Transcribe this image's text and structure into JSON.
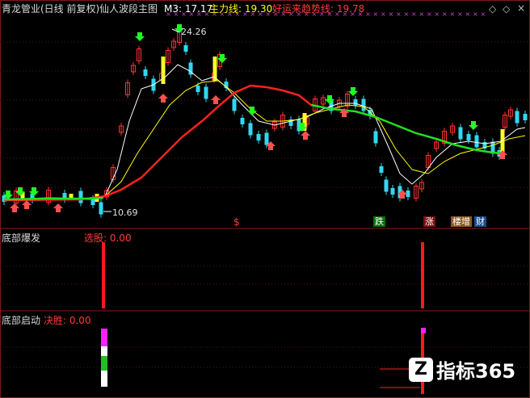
{
  "header": {
    "stock": "青龙管业(日线 前复权)",
    "indicator": "仙人波段主图",
    "m3": "M3: 17.17",
    "main_line": "主力线: 19.30",
    "trend_line": "好运来趋势线: 19.78",
    "colors": {
      "stock": "#d8d8d8",
      "m3": "#ffffff",
      "main_line": "#ffff00",
      "trend_line": "#ff3b3b"
    }
  },
  "controls": {
    "up": "◇",
    "down": "◇",
    "close": "×"
  },
  "panel1": {
    "price_high": "24.26",
    "price_low": "10.69",
    "signal_tags": [
      {
        "text": "跌",
        "bg": "#0a6e0a",
        "fg": "#ffffff"
      },
      {
        "text": "涨",
        "bg": "#7a1010",
        "fg": "#ffffff"
      },
      {
        "text": "楼增",
        "bg": "#8a5a20",
        "fg": "#ffffff"
      },
      {
        "text": "财",
        "bg": "#1a4a8a",
        "fg": "#ffffff"
      }
    ],
    "money_icon": "$"
  },
  "panel2": {
    "name": "底部爆发",
    "sub": "选股: 0.00"
  },
  "panel3": {
    "name": "底部启动",
    "sub": "决胜: 0.00"
  },
  "logo": {
    "text": "指标365",
    "mark": "Z"
  },
  "chart_data": {
    "type": "candlestick",
    "title": "青龙管业(日线 前复权) 仙人波段主图",
    "y_marks": {
      "high": 24.26,
      "low": 10.69
    },
    "series": [
      {
        "name": "M3",
        "color": "#ffffff",
        "last": 17.17
      },
      {
        "name": "主力线",
        "color": "#ffff00",
        "last": 19.3
      },
      {
        "name": "好运来趋势线",
        "color": "#ff3b3b",
        "last": 19.78
      }
    ],
    "panels": [
      {
        "name": "底部爆发",
        "series": [
          {
            "name": "选股",
            "last": 0.0
          }
        ]
      },
      {
        "name": "底部启动",
        "series": [
          {
            "name": "决胜",
            "last": 0.0
          }
        ]
      }
    ]
  }
}
